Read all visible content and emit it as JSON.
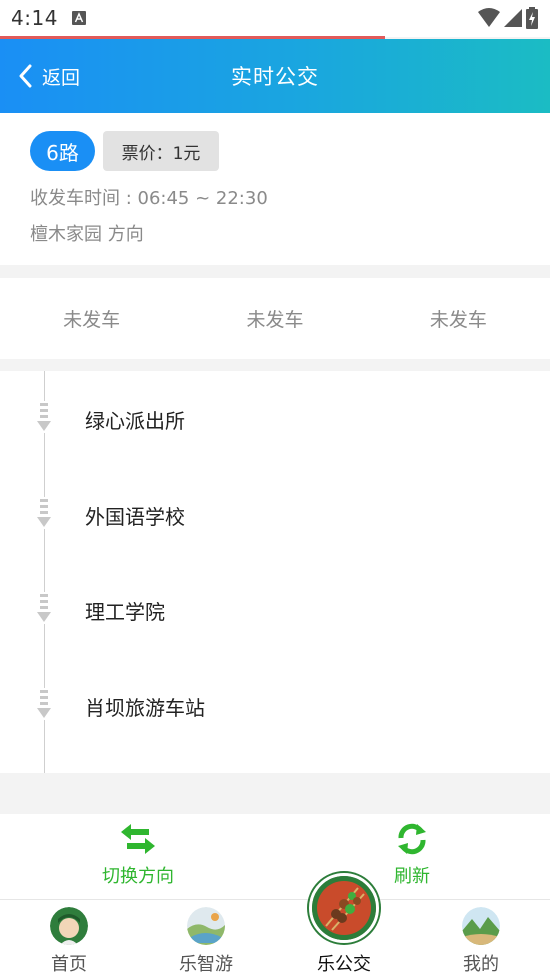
{
  "status_bar": {
    "time": "4:14",
    "notification_icon": "a-icon",
    "icons": [
      "wifi-icon",
      "cellular-icon",
      "battery-charging-icon"
    ]
  },
  "header": {
    "back_label": "返回",
    "title": "实时公交"
  },
  "route": {
    "number": "6路",
    "fare": "票价：1元",
    "hours": "收发车时间 : 06:45 ~ 22:30",
    "direction": "檀木家园 方向"
  },
  "bus_status": [
    "未发车",
    "未发车",
    "未发车"
  ],
  "stops": [
    {
      "name": "绿心派出所"
    },
    {
      "name": "外国语学校"
    },
    {
      "name": "理工学院"
    },
    {
      "name": "肖坝旅游车站"
    }
  ],
  "actions": {
    "switch_direction": "切换方向",
    "refresh": "刷新"
  },
  "tabs": [
    {
      "label": "首页",
      "icon": "home-avatar-icon"
    },
    {
      "label": "乐智游",
      "icon": "travel-icon"
    },
    {
      "label": "乐公交",
      "icon": "bus-food-icon"
    },
    {
      "label": "我的",
      "icon": "profile-landscape-icon"
    }
  ],
  "colors": {
    "header_start": "#1a8ff5",
    "header_end": "#1bbcc4",
    "accent_blue": "#1a8ff5",
    "action_green": "#2fb62f",
    "progress_red": "#e15a5a"
  }
}
